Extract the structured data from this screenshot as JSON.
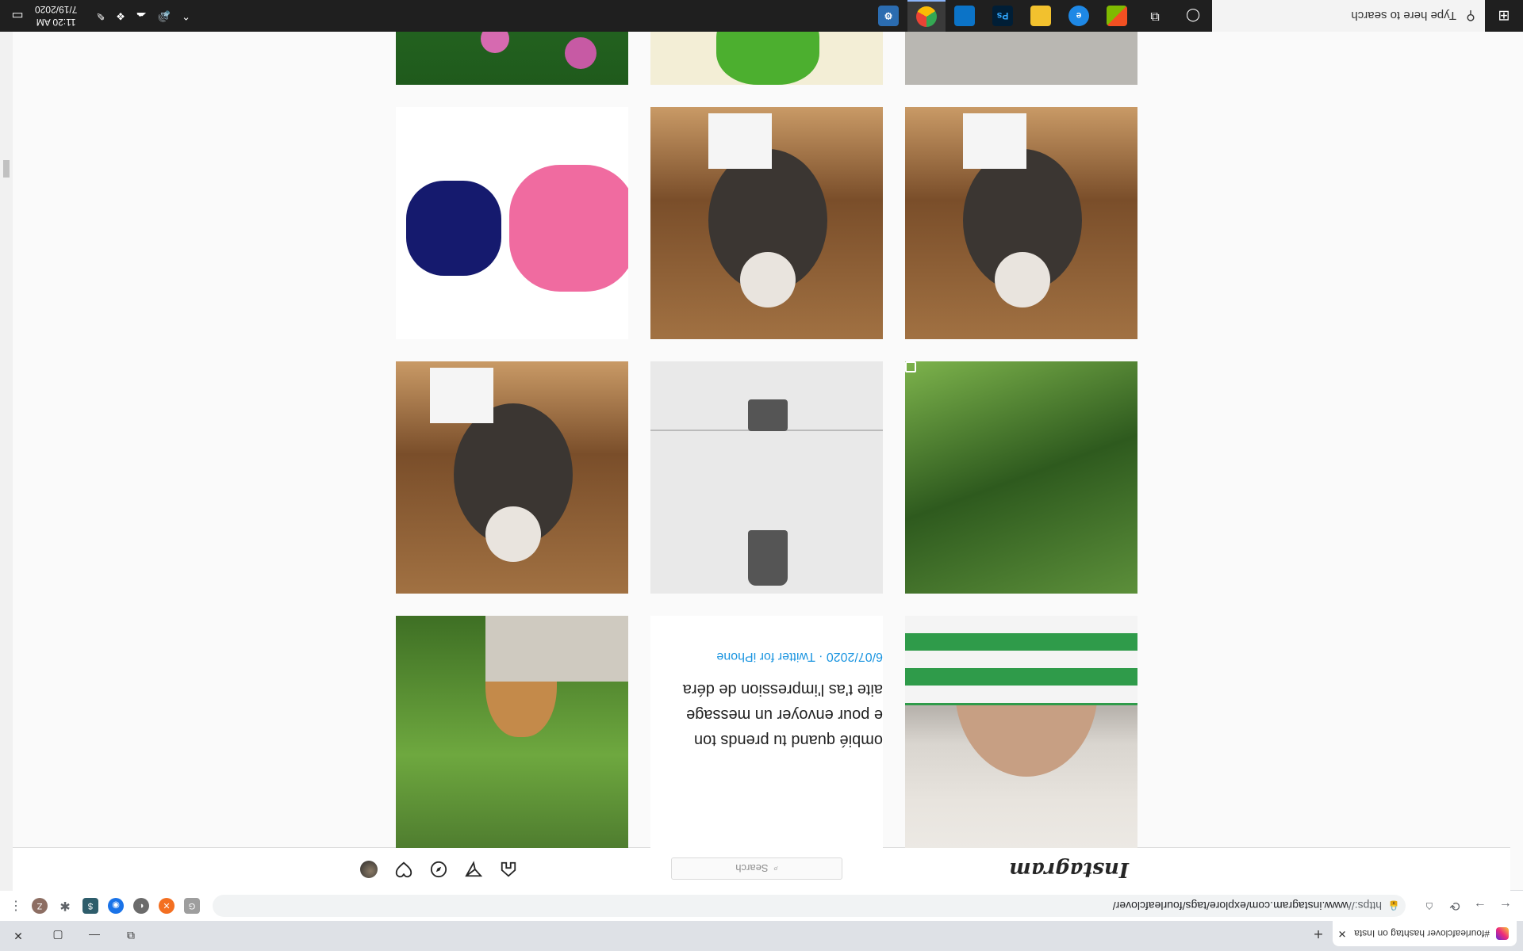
{
  "taskbar": {
    "search_placeholder": "Type here to search",
    "time": "11:20 AM",
    "date": "7/19/2020",
    "apps": [
      "cortana-icon",
      "task-view-icon",
      "microsoft-store-icon",
      "edge-icon",
      "file-explorer-icon",
      "photoshop-icon",
      "photos-icon",
      "chrome-icon",
      "settings-icon"
    ]
  },
  "browser": {
    "tab_title": "#fourleafclover hashtag on Insta",
    "url_scheme": "https://",
    "url_rest": "www.instagram.com/explore/tags/fourleafclover/",
    "extension_letter": "Z"
  },
  "instagram": {
    "logo": "Instagram",
    "search_placeholder": "Search"
  },
  "tweet_tile": {
    "line1": "ombié quand tu prends ton",
    "line2": "e pour envoyer un message",
    "line3": "aite t'as l'impression de déra",
    "meta": "6/07/2020 · Twitter for iPhone"
  },
  "colors": {
    "taskbar_bg": "#1f1f1f",
    "chrome_tabbar": "#dee1e6",
    "link_blue": "#1b95e0",
    "ig_border": "#dbdbdb"
  }
}
